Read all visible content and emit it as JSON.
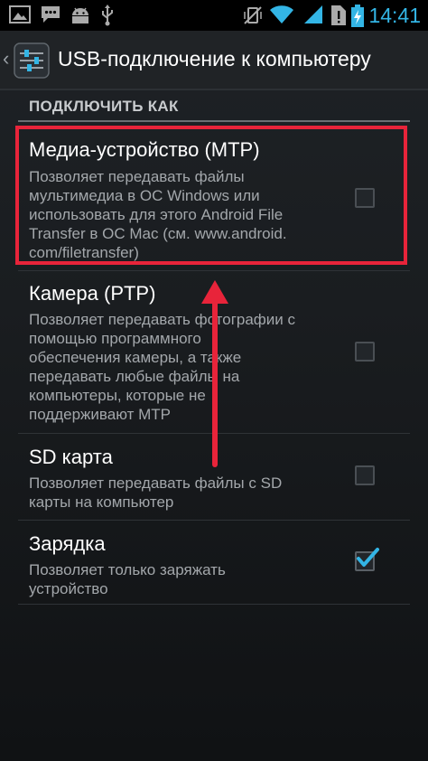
{
  "status_bar": {
    "time": "14:41",
    "icons": [
      "picture-icon",
      "chat-icon",
      "android-icon",
      "usb-icon",
      "vibrate-off-icon",
      "wifi-icon",
      "signal-icon",
      "sync-error-icon",
      "battery-icon"
    ],
    "accent": "#33b5e5"
  },
  "action_bar": {
    "title": "USB-подключение к компьютеру"
  },
  "section": {
    "header": "ПОДКЛЮЧИТЬ КАК"
  },
  "items": [
    {
      "title": "Медиа-устройство (MTP)",
      "summary_lines": [
        "Позволяет передавать файлы",
        "мультимедиа в ОС Windows или",
        "использовать для этого Android File",
        "Transfer в ОС Mac (см. www.android.",
        "com/filetransfer)"
      ],
      "checked": false
    },
    {
      "title": "Камера (PTP)",
      "summary_lines": [
        "Позволяет передавать фотографии с",
        "помощью программного",
        "обеспечения камеры, а также",
        "передавать любые файлы на",
        "компьютеры, которые не",
        "поддерживают MTP"
      ],
      "checked": false
    },
    {
      "title": "SD карта",
      "summary_lines": [
        "Позволяет передавать файлы с SD",
        "карты на компьютер"
      ],
      "checked": false
    },
    {
      "title": "Зарядка",
      "summary_lines": [
        "Позволяет только заряжать",
        "устройство"
      ],
      "checked": true
    }
  ],
  "annotation": {
    "highlight_color": "#e8243a",
    "highlighted_item": "Медиа-устройство (MTP)"
  }
}
